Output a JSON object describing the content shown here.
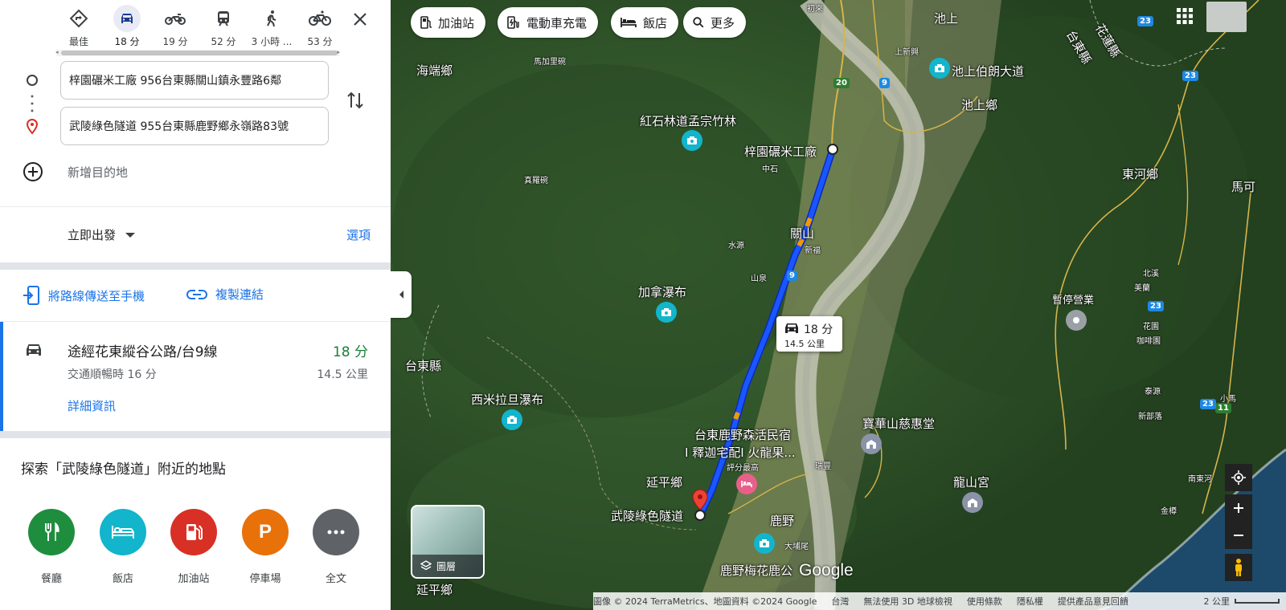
{
  "travel_modes": [
    {
      "icon": "best-route-icon",
      "label": "最佳",
      "active": false
    },
    {
      "icon": "car-icon",
      "label": "18 分",
      "active": true
    },
    {
      "icon": "motorcycle-icon",
      "label": "19 分",
      "active": false
    },
    {
      "icon": "transit-icon",
      "label": "52 分",
      "active": false
    },
    {
      "icon": "walk-icon",
      "label": "3 小時 ...",
      "active": false
    },
    {
      "icon": "bicycle-icon",
      "label": "53 分",
      "active": false
    }
  ],
  "origin": "梓園碾米工廠 956台東縣關山鎮永豐路6鄰",
  "destination": "武陵綠色隧道 955台東縣鹿野鄉永嶺路83號",
  "add_destination": "新增目的地",
  "depart_label": "立即出發",
  "options_label": "選項",
  "send_to_phone": "將路線傳送至手機",
  "copy_link": "複製連結",
  "route": {
    "name": "途經花東縱谷公路/台9線",
    "time": "18 分",
    "traffic": "交通順暢時 16 分",
    "distance": "14.5 公里",
    "details": "詳細資訊"
  },
  "explore_title": "探索「武陵綠色隧道」附近的地點",
  "categories": [
    {
      "label": "餐廳",
      "icon": "restaurant-icon",
      "color": "#1e8e3e"
    },
    {
      "label": "飯店",
      "icon": "hotel-icon",
      "color": "#12b5cb"
    },
    {
      "label": "加油站",
      "icon": "gas-station-icon",
      "color": "#d93025"
    },
    {
      "label": "停車場",
      "icon": "parking-icon",
      "color": "#e8710a"
    },
    {
      "label": "全文",
      "icon": "more-icon",
      "color": "#5f6368"
    }
  ],
  "map_chips": [
    {
      "label": "加油站",
      "icon": "gas-icon"
    },
    {
      "label": "電動車充電",
      "icon": "ev-charger-icon"
    },
    {
      "label": "飯店",
      "icon": "bed-icon"
    },
    {
      "label": "更多",
      "icon": "search-icon"
    }
  ],
  "map_labels": {
    "chishang": "池上",
    "haiduan": "海端鄉",
    "chishang_boulevard": "池上伯朗大道",
    "chishang_township": "池上鄉",
    "hongshi": "紅石林道孟宗竹林",
    "ziyuan": "梓園碾米工廠",
    "guanshan": "關山",
    "donghe": "東河鄉",
    "maxi": "馬可",
    "jiana": "加拿瀑布",
    "taitung_county": "台東縣",
    "ximilada": "西米拉旦瀑布",
    "paused": "暫停營業",
    "hostel_line1": "台東鹿野森活民宿",
    "hostel_line2": "I 釋迦宅配I 火龍果...",
    "hostel_rating": "評分最高",
    "baohuashan": "寶華山慈惠堂",
    "yanping": "延平鄉",
    "wuling": "武陵綠色隧道",
    "luye": "鹿野",
    "longshan": "龍山宮",
    "luye_meihua": "鹿野梅花鹿公",
    "yanping_bottom": "延平鄉",
    "taidong_county_ne": "台東縣",
    "hualien": "花蓮縣"
  },
  "map_small_labels": {
    "chuxiang": "初來",
    "mahai": "馬加里碗",
    "shangxin": "上新興",
    "zhongshi": "中石",
    "zhenluo": "真羅碗",
    "shuiyuan": "水源",
    "xinfu": "新福",
    "shanquan": "山泉",
    "beixi": "北溪",
    "meilan": "美蘭",
    "huayuan": "花園",
    "galuolan": "咖啡園",
    "taiyuan": "泰源",
    "xiaoma": "小馬",
    "xinbuluo": "新部落",
    "nandonghe": "南東河",
    "jinfeng": "金樽",
    "dazhuwei": "大埔尾",
    "ruifeng": "瑞豐"
  },
  "road_shields": [
    "20",
    "9",
    "9",
    "23",
    "23",
    "23",
    "11",
    "23"
  ],
  "route_callout": {
    "time": "18 分",
    "distance": "14.5 公里"
  },
  "layers_label": "圖層",
  "google_logo": "Google",
  "footer": {
    "copyright": "圖像 © 2024 TerraMetrics、地圖資料 ©2024 Google",
    "region": "台灣",
    "no3d": "無法使用 3D 地球檢視",
    "terms": "使用條款",
    "privacy": "隱私權",
    "feedback": "提供產品意見回饋",
    "scale": "2 公里"
  },
  "colors": {
    "route": "#1a56ff",
    "accent": "#1a73e8",
    "green_time": "#188038"
  }
}
